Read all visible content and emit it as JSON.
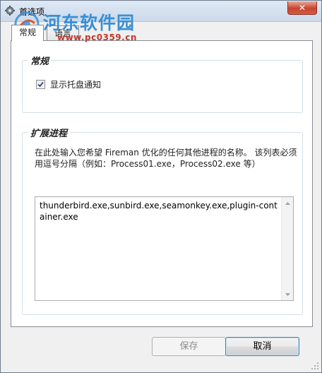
{
  "window": {
    "title": "首选项",
    "close_label": "✕"
  },
  "watermark": {
    "title": "河东软件园",
    "url": "www.pc0359.cn"
  },
  "tabs": [
    {
      "label": "常规",
      "active": true
    },
    {
      "label": "语言",
      "active": false
    }
  ],
  "general": {
    "legend": "常规",
    "tray_checkbox_label": "显示托盘通知",
    "tray_checked": true
  },
  "extended": {
    "legend": "扩展进程",
    "description": "在此处输入您希望 Fireman 优化的任何其他进程的名称。 该列表必须用逗号分隔（例如：Process01.exe，Process02.exe 等）",
    "processes_value": "thunderbird.exe,sunbird.exe,seamonkey.exe,plugin-container.exe"
  },
  "buttons": {
    "save_label": "保存",
    "cancel_label": "取消"
  }
}
